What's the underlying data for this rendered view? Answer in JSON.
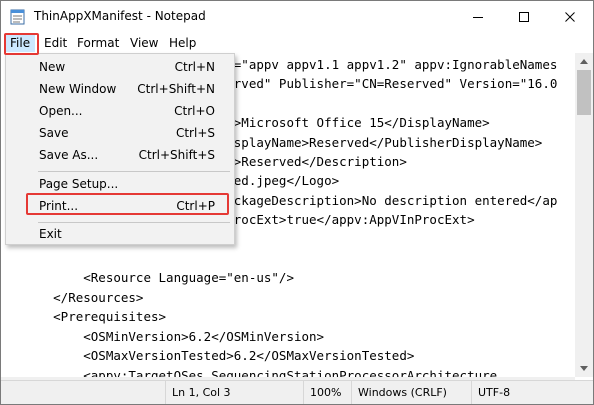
{
  "window": {
    "title": "ThinAppXManifest - Notepad"
  },
  "menubar": {
    "items": [
      {
        "label": "File"
      },
      {
        "label": "Edit"
      },
      {
        "label": "Format"
      },
      {
        "label": "View"
      },
      {
        "label": "Help"
      }
    ]
  },
  "file_menu": {
    "items": [
      {
        "label": "New",
        "shortcut": "Ctrl+N"
      },
      {
        "label": "New Window",
        "shortcut": "Ctrl+Shift+N"
      },
      {
        "label": "Open...",
        "shortcut": "Ctrl+O"
      },
      {
        "label": "Save",
        "shortcut": "Ctrl+S"
      },
      {
        "label": "Save As...",
        "shortcut": "Ctrl+Shift+S"
      },
      {
        "label": "Page Setup...",
        "shortcut": ""
      },
      {
        "label": "Print...",
        "shortcut": "Ctrl+P"
      },
      {
        "label": "Exit",
        "shortcut": ""
      }
    ]
  },
  "editor": {
    "lines": [
      "                              =\"appv appv1.1 appv1.2\" appv:IgnorableNames",
      "                              rved\" Publisher=\"CN=Reserved\" Version=\"16.0",
      "",
      "                              >Microsoft Office 15</DisplayName>",
      "                              splayName>Reserved</PublisherDisplayName>",
      "                              >Reserved</Description>",
      "                              ed.jpeg</Logo>",
      "                              ckageDescription>No description entered</ap",
      "                              rocExt>true</appv:AppVInProcExt>",
      "",
      "",
      "          <Resource Language=\"en-us\"/>",
      "      </Resources>",
      "      <Prerequisites>",
      "          <OSMinVersion>6.2</OSMinVersion>",
      "          <OSMaxVersionTested>6.2</OSMaxVersionTested>",
      "          <appv:TargetOSes SequencingStationProcessorArchitecture"
    ]
  },
  "status": {
    "position": "Ln 1, Col 3",
    "zoom": "100%",
    "line_ending": "Windows (CRLF)",
    "encoding": "UTF-8"
  },
  "colors": {
    "highlight_box": "#e53935",
    "menu_active": "#cce8ff",
    "dropdown_bg": "#f2f2f2"
  },
  "icons": [
    "notepad-icon",
    "minimize-icon",
    "maximize-icon",
    "close-icon",
    "scroll-up-arrow-icon",
    "scroll-down-arrow-icon"
  ]
}
